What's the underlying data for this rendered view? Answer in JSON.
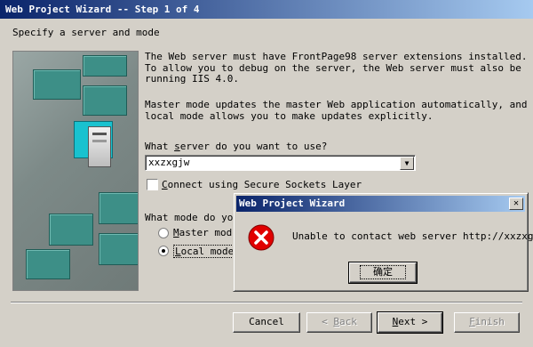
{
  "window": {
    "title": "Web Project Wizard -- Step 1 of 4"
  },
  "subtitle": "Specify a server and mode",
  "description": {
    "lines": [
      "The Web server must have FrontPage98 server extensions installed.",
      "To allow you to debug on the server, the Web server must also be",
      "running IIS 4.0."
    ],
    "mode_lines": [
      "Master mode updates the master Web application automatically, and",
      "local mode allows you to make updates explicitly."
    ]
  },
  "server": {
    "question_prefix": "What ",
    "question_underlined": "s",
    "question_suffix": "erver do you want to use?",
    "value": "xxzxgjw",
    "dropdown_icon": "chevron-down-icon"
  },
  "ssl": {
    "label_prefix": "",
    "label_underlined": "C",
    "label_suffix": "onnect using Secure Sockets Layer",
    "checked": false
  },
  "mode": {
    "question": "What mode do you",
    "options": [
      {
        "underlined": "M",
        "rest": "aster mode",
        "selected": false
      },
      {
        "underlined": "L",
        "rest": "ocal mode",
        "selected": true
      }
    ]
  },
  "buttons": {
    "cancel": "Cancel",
    "back_prefix": "< ",
    "back_underlined": "B",
    "back_rest": "ack",
    "next_underlined": "N",
    "next_rest": "ext >",
    "finish_underlined": "F",
    "finish_rest": "inish"
  },
  "dialog": {
    "title": "Web Project Wizard",
    "close_icon": "close-icon",
    "icon": "error-icon",
    "message": "Unable to contact web server http://xxzxgjw",
    "ok": "确定"
  },
  "colors": {
    "titlebar_start": "#0a246a",
    "titlebar_end": "#a6caf0",
    "face": "#d4d0c8",
    "error_red": "#e00000"
  }
}
